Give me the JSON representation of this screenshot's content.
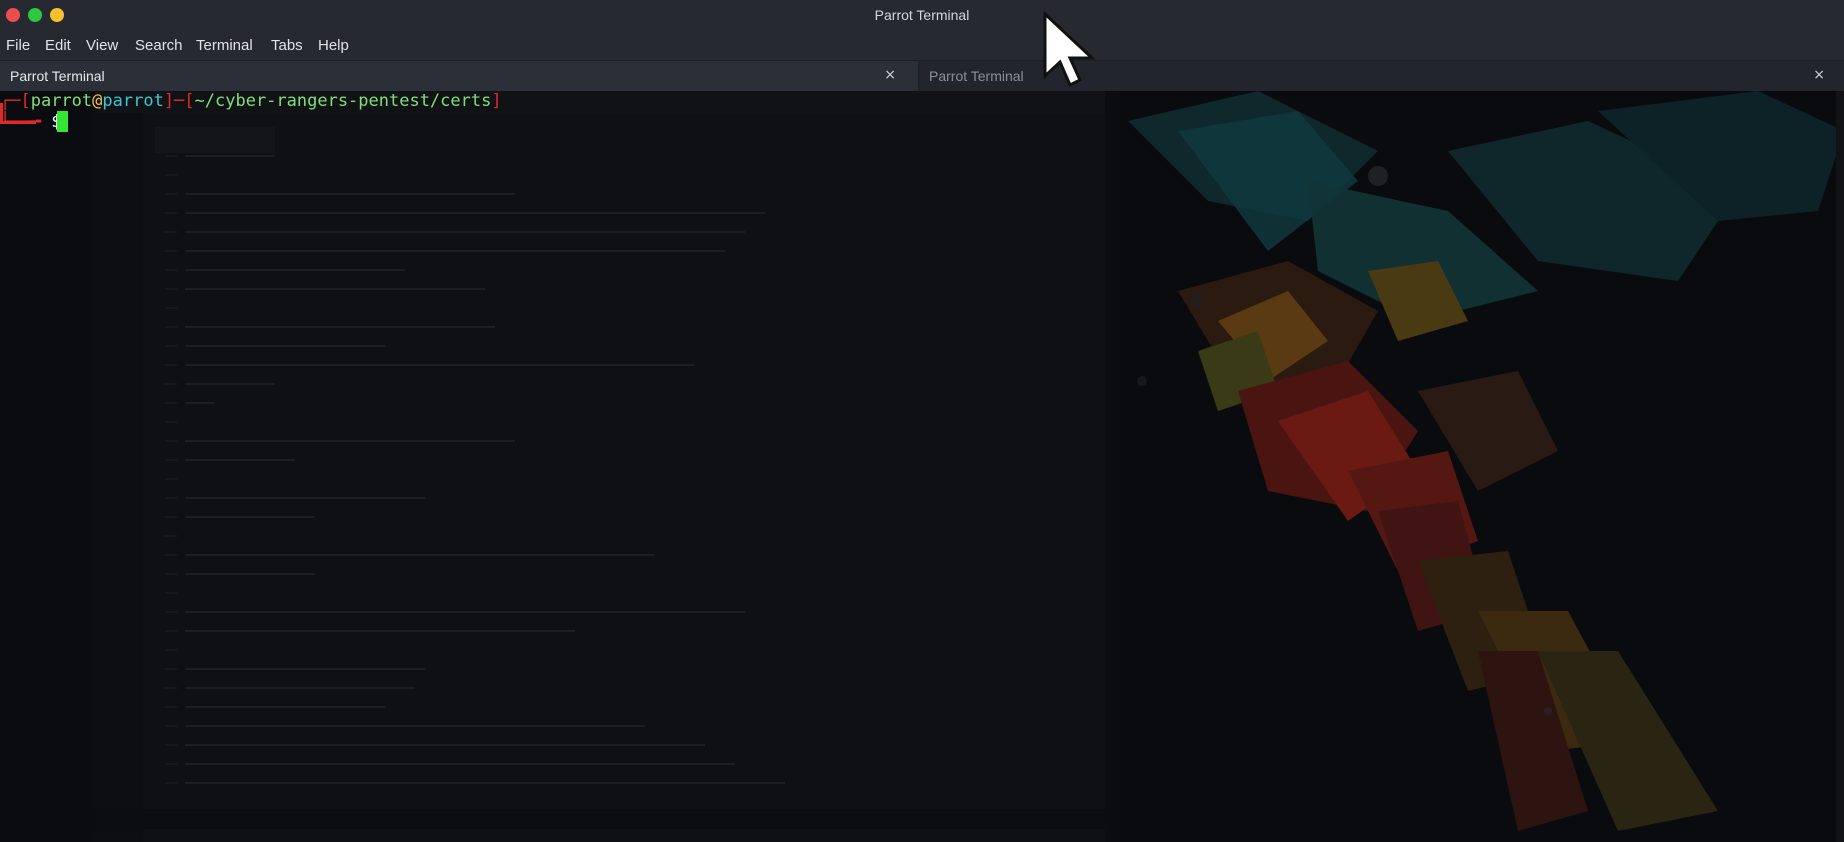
{
  "window": {
    "title": "Parrot Terminal"
  },
  "menubar": {
    "items": [
      "File",
      "Edit",
      "View",
      "Search",
      "Terminal",
      "Tabs",
      "Help"
    ]
  },
  "tabs": [
    {
      "label": "Parrot Terminal",
      "close": "×",
      "active": true
    },
    {
      "label": "Parrot Terminal",
      "close": "×",
      "active": false
    }
  ],
  "terminal": {
    "prompt": {
      "open_bracket": "┌─[",
      "user": "parrot",
      "at": "@",
      "host": "parrot",
      "sep": "]─[",
      "path": "~/cyber-rangers-pentest/certs",
      "close_bracket": "]",
      "second_line_prefix": "└──╼ ",
      "dollar": "$"
    }
  },
  "colors": {
    "prompt_bracket": "#e02a2a",
    "user": "#7ee07a",
    "at": "#f0c14a",
    "host": "#38c7d3",
    "path": "#7ee07a",
    "cursor": "#34e534"
  }
}
